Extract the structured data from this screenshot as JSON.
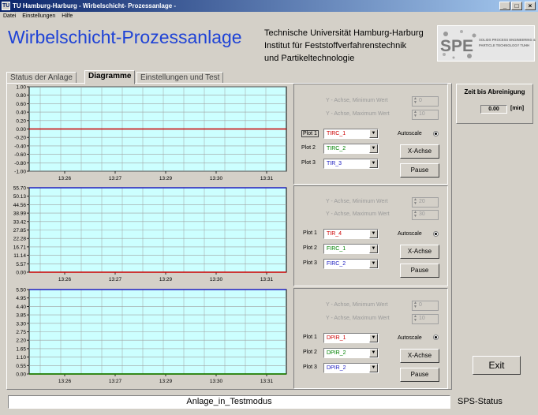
{
  "window": {
    "title": "TU Hamburg-Harburg - Wirbelschicht- Prozessanlage -",
    "icon_text": "TU",
    "buttons": {
      "minimize": "_",
      "maximize": "□",
      "close": "×"
    }
  },
  "menu": [
    "Datei",
    "Einstellungen",
    "Hilfe"
  ],
  "header": {
    "title": "Wirbelschicht-Prozessanlage",
    "institution": [
      "Technische Universität Hamburg-Harburg",
      "Institut für Feststoffverfahrenstechnik",
      "und Partikeltechnologie"
    ],
    "logo": {
      "name": "spe-logo",
      "letters": "SPE",
      "caption1": "SOLIDS PROCESS ENGINEERING &",
      "caption2": "PARTICLE TECHNOLOGY TUHH"
    }
  },
  "tabs": [
    {
      "label": "Status der Anlage",
      "active": false
    },
    {
      "label": "Diagramme",
      "active": true
    },
    {
      "label": "Einstellungen und Test",
      "active": false
    }
  ],
  "chart_data": [
    {
      "type": "line",
      "ylim": [
        -1.0,
        1.0
      ],
      "yticks": [
        "1.00",
        "0.80",
        "0.60",
        "0.40",
        "0.20",
        "0.00",
        "-0.20",
        "-0.40",
        "-0.60",
        "-0.80",
        "-1.00"
      ],
      "x_ticks": [
        "13:26",
        "13:27",
        "13:29",
        "13:30",
        "13:31"
      ],
      "series": [
        {
          "name": "TIRC_1",
          "color": "#cc0000",
          "values": [
            0,
            0,
            0,
            0,
            0,
            0
          ]
        }
      ]
    },
    {
      "type": "line",
      "ylim": [
        0.0,
        55.7
      ],
      "yticks": [
        "55.70",
        "50.13",
        "44.56",
        "38.99",
        "33.42",
        "27.85",
        "22.28",
        "16.71",
        "11.14",
        "5.57",
        "0.00"
      ],
      "x_ticks": [
        "13:26",
        "13:27",
        "13:29",
        "13:30",
        "13:31"
      ],
      "series": [
        {
          "name": "TIR_4",
          "color": "#cc0000",
          "values": [
            0,
            0,
            0,
            0,
            0,
            0
          ]
        },
        {
          "name": "FIRC_2",
          "color": "#2020c0",
          "values": [
            55.7,
            55.7,
            55.7,
            55.7,
            55.7,
            55.7
          ]
        }
      ]
    },
    {
      "type": "line",
      "ylim": [
        0.0,
        5.5
      ],
      "yticks": [
        "5.50",
        "4.95",
        "4.40",
        "3.85",
        "3.30",
        "2.75",
        "2.20",
        "1.65",
        "1.10",
        "0.55",
        "0.00"
      ],
      "x_ticks": [
        "13:26",
        "13:27",
        "13:29",
        "13:30",
        "13:31"
      ],
      "series": [
        {
          "name": "DPIR_1",
          "color": "#cc0000",
          "values": [
            0,
            0,
            0,
            0,
            0,
            0
          ]
        },
        {
          "name": "DPIR_2",
          "color": "#009000",
          "values": [
            0,
            0,
            0,
            0,
            0,
            0
          ]
        },
        {
          "name": "DPIR_2",
          "color": "#2020c0",
          "values": [
            5.5,
            5.5,
            5.5,
            5.5,
            5.5,
            5.5
          ]
        }
      ]
    }
  ],
  "panels": [
    {
      "ymin_label": "Y - Achse, Minimum Wert",
      "ymin": "0",
      "ymax_label": "Y - Achse, Maximum Wert",
      "ymax": "10",
      "plots": [
        {
          "label": "Plot 1",
          "value": "TIRC_1",
          "color": "#cc0000"
        },
        {
          "label": "Plot 2",
          "value": "TIRC_2",
          "color": "#008000"
        },
        {
          "label": "Plot 3",
          "value": "TIR_3",
          "color": "#2020c0"
        }
      ],
      "autoscale": "Autoscale",
      "xaxis": "X-Achse",
      "pause": "Pause"
    },
    {
      "ymin_label": "Y - Achse, Minimum Wert",
      "ymin": "20",
      "ymax_label": "Y - Achse, Maximum Wert",
      "ymax": "30",
      "plots": [
        {
          "label": "Plot 1",
          "value": "TIR_4",
          "color": "#cc0000"
        },
        {
          "label": "Plot 2",
          "value": "FIRC_1",
          "color": "#008000"
        },
        {
          "label": "Plot 3",
          "value": "FIRC_2",
          "color": "#2020c0"
        }
      ],
      "autoscale": "Autoscale",
      "xaxis": "X-Achse",
      "pause": "Pause"
    },
    {
      "ymin_label": "Y - Achse, Minimum Wert",
      "ymin": "0",
      "ymax_label": "Y - Achse, Maximum Wert",
      "ymax": "10",
      "plots": [
        {
          "label": "Plot 1",
          "value": "DPIR_1",
          "color": "#cc0000"
        },
        {
          "label": "Plot 2",
          "value": "DPIR_2",
          "color": "#008000"
        },
        {
          "label": "Plot 3",
          "value": "DPIR_2",
          "color": "#2020c0"
        }
      ],
      "autoscale": "Autoscale",
      "xaxis": "X-Achse",
      "pause": "Pause"
    }
  ],
  "time_box": {
    "label": "Zeit bis Abreinigung",
    "value": "0.00",
    "unit": "[min]"
  },
  "exit_label": "Exit",
  "status": {
    "text": "Anlage_in_Testmodus",
    "label": "SPS-Status"
  },
  "colors": {
    "plot_bg": "#ccffff",
    "grid": "#9fa0a0",
    "title": "#1f43d6"
  }
}
